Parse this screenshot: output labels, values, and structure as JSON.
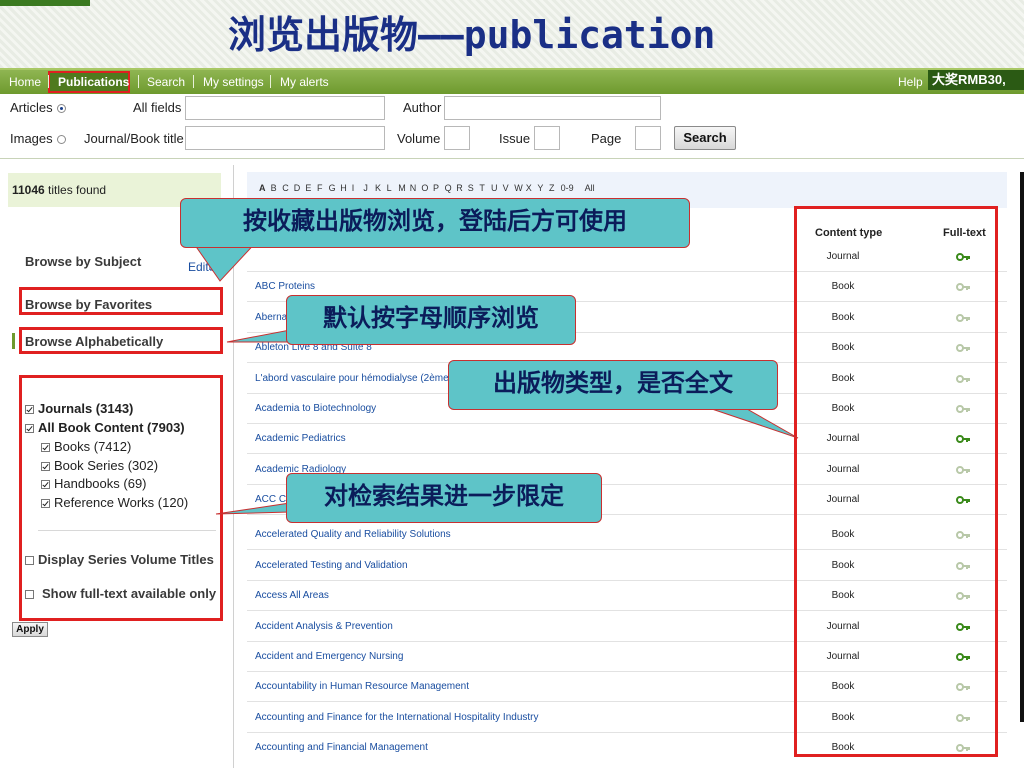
{
  "slide_title": "浏览出版物——publication",
  "nav": {
    "items": [
      "Home",
      "Publications",
      "Search",
      "My settings",
      "My alerts"
    ],
    "help": "Help",
    "banner": "大奖RMB30,"
  },
  "search": {
    "articles_label": "Articles",
    "images_label": "Images",
    "all_fields_label": "All fields",
    "journal_title_label": "Journal/Book title",
    "author_label": "Author",
    "volume_label": "Volume",
    "issue_label": "Issue",
    "page_label": "Page",
    "search_button": "Search",
    "articles_selected": true
  },
  "left": {
    "found_count": "11046",
    "found_suffix": " titles found",
    "browse_subject": "Browse by Subject",
    "edit_link": "Edit",
    "browse_favorites": "Browse by Favorites",
    "browse_alpha": "Browse Alphabetically",
    "filters": [
      {
        "label": "Journals (3143)",
        "checked": true
      },
      {
        "label": "All Book Content (7903)",
        "checked": true
      },
      {
        "label": "Books (7412)",
        "checked": true
      },
      {
        "label": "Book Series (302)",
        "checked": true
      },
      {
        "label": "Handbooks (69)",
        "checked": true
      },
      {
        "label": "Reference Works (120)",
        "checked": true
      }
    ],
    "display_series": "Display Series Volume Titles",
    "show_fulltext": "Show full-text available only",
    "apply_button": "Apply"
  },
  "alphabet": [
    "A",
    "B",
    "C",
    "D",
    "E",
    "F",
    "G",
    "H",
    "I",
    "J",
    "K",
    "L",
    "M",
    "N",
    "O",
    "P",
    "Q",
    "R",
    "S",
    "T",
    "U",
    "V",
    "W",
    "X",
    "Y",
    "Z",
    "0-9",
    "All"
  ],
  "columns": {
    "content_type": "Content type",
    "full_text": "Full-text"
  },
  "rows": [
    {
      "title": "",
      "type": "Journal",
      "full": true
    },
    {
      "title": "ABC Proteins",
      "type": "Book",
      "full": false
    },
    {
      "title": "Aberna",
      "type": "Book",
      "full": false
    },
    {
      "title": "Ableton Live 8 and Suite 8",
      "type": "Book",
      "full": false
    },
    {
      "title": "L'abord vasculaire pour hémodialyse (2ème",
      "type": "Book",
      "full": false
    },
    {
      "title": "Academia to Biotechnology",
      "type": "Book",
      "full": false
    },
    {
      "title": "Academic Pediatrics",
      "type": "Journal",
      "full": true
    },
    {
      "title": "Academic Radiology",
      "type": "Journal",
      "full": false
    },
    {
      "title": "ACC C",
      "type": "Journal",
      "full": true
    },
    {
      "title": "Accelerated Quality and Reliability Solutions",
      "type": "Book",
      "full": false
    },
    {
      "title": "Accelerated Testing and Validation",
      "type": "Book",
      "full": false
    },
    {
      "title": "Access All Areas",
      "type": "Book",
      "full": false
    },
    {
      "title": "Accident Analysis & Prevention",
      "type": "Journal",
      "full": true
    },
    {
      "title": "Accident and Emergency Nursing",
      "type": "Journal",
      "full": true
    },
    {
      "title": "Accountability in Human Resource Management",
      "type": "Book",
      "full": false
    },
    {
      "title": "Accounting and Finance for the International Hospitality Industry",
      "type": "Book",
      "full": false
    },
    {
      "title": "Accounting and Financial Management",
      "type": "Book",
      "full": false
    }
  ],
  "colors": {
    "key_full": "#3a8a1a",
    "key_partial": "#b8c8a8",
    "callout": "#5ec4c8",
    "highlight": "#e02020"
  },
  "callouts": {
    "favorites": "按收藏出版物浏览，登陆后方可使用",
    "alpha": "默认按字母顺序浏览",
    "type": "出版物类型，是否全文",
    "filter": "对检索结果进一步限定"
  }
}
